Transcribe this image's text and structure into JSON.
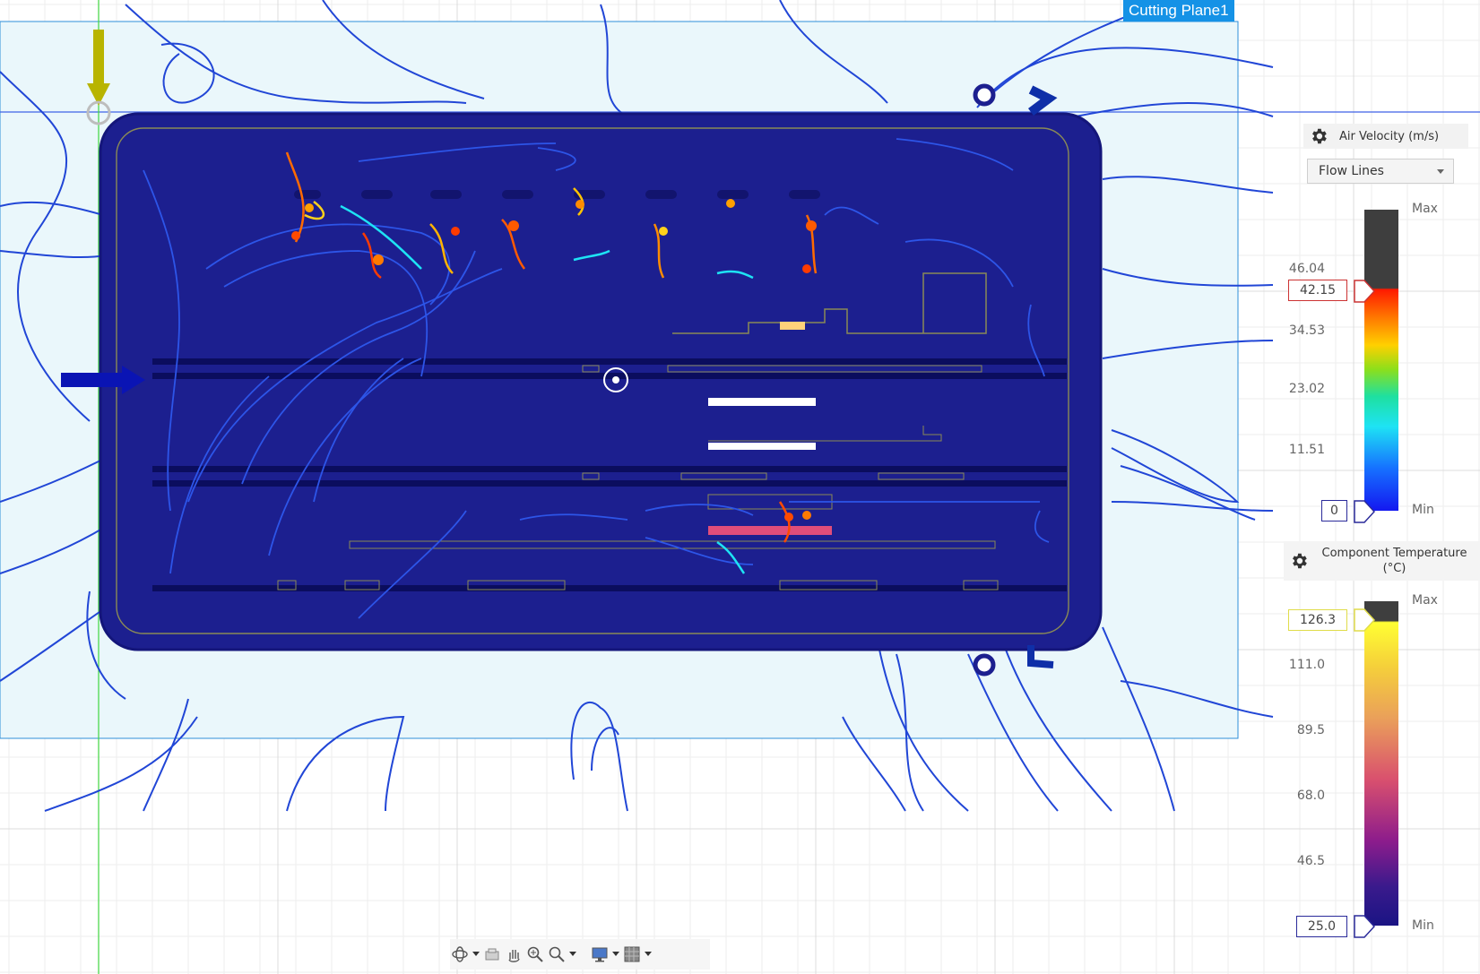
{
  "viewport": {
    "cutting_plane_label": "Cutting Plane1",
    "accent_colors": {
      "plane_blue": "#1592e6",
      "enclosure": "#1c1f8f",
      "flow_line": "#2146d6",
      "inlet_arrow": "#0a14b4",
      "gravity_arrow": "#b8b400"
    }
  },
  "air_velocity_legend": {
    "title": "Air Velocity (m/s)",
    "display_mode": "Flow Lines",
    "max_label": "Max",
    "min_label": "Min",
    "ticks": [
      "46.04",
      "34.53",
      "23.02",
      "11.51"
    ],
    "max_value": "42.15",
    "min_value": "0",
    "icon": "gear-icon"
  },
  "temperature_legend": {
    "title": "Component Temperature",
    "unit": "(°C)",
    "max_label": "Max",
    "min_label": "Min",
    "ticks": [
      "111.0",
      "89.5",
      "68.0",
      "46.5"
    ],
    "max_value": "126.3",
    "min_value": "25.0",
    "icon": "gear-icon"
  },
  "toolbar": {
    "icons": [
      "orbit-icon",
      "look-at-icon",
      "pan-icon",
      "zoom-icon",
      "fit-icon",
      "display-settings-icon",
      "grid-settings-icon"
    ]
  }
}
